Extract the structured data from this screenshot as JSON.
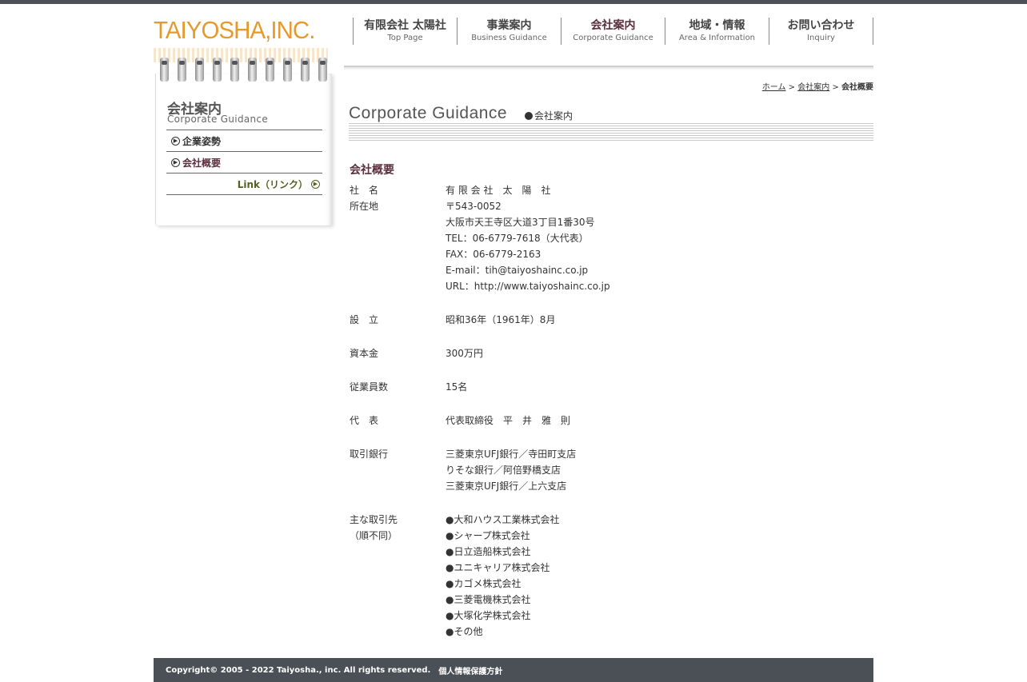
{
  "brand": {
    "logo_text": "TAIYOSHA,INC."
  },
  "global_nav": [
    {
      "jp": "有限会社 太陽社",
      "en": "Top Page"
    },
    {
      "jp": "事業案内",
      "en": "Business Guidance"
    },
    {
      "jp": "会社案内",
      "en": "Corporate Guidance"
    },
    {
      "jp": "地域・情報",
      "en": "Area & Information"
    },
    {
      "jp": "お問い合わせ",
      "en": "Inquiry"
    }
  ],
  "sidebar": {
    "title_jp": "会社案内",
    "title_en": "Corporate Guidance",
    "items": [
      {
        "label": "企業姿勢"
      },
      {
        "label": "会社概要"
      }
    ],
    "link_label": "Link（リンク）"
  },
  "breadcrumb": {
    "home": "ホーム",
    "sep1": ">",
    "section": "会社案内",
    "sep2": ">",
    "current": "会社概要"
  },
  "page_title": {
    "en": "Corporate Guidance",
    "jp": "会社案内"
  },
  "section_heading": "会社概要",
  "company_info": {
    "name": {
      "label": "社　名",
      "value": "有 限 会 社　太　陽　社"
    },
    "address": {
      "label": "所在地",
      "lines": [
        "〒543-0052",
        "大阪市天王寺区大道3丁目1番30号",
        "TEL：06-6779-7618（大代表）",
        "FAX：06-6779-2163",
        "E-mail：tih@taiyoshainc.co.jp",
        "URL：http://www.taiyoshainc.co.jp"
      ]
    },
    "founded": {
      "label": "設　立",
      "value": "昭和36年（1961年）8月"
    },
    "capital": {
      "label": "資本金",
      "value": "300万円"
    },
    "employees": {
      "label": "従業員数",
      "value": "15名"
    },
    "representative": {
      "label": "代　表",
      "value": "代表取締役　平　井　雅　則"
    },
    "banks": {
      "label": "取引銀行",
      "lines": [
        "三菱東京UFJ銀行／寺田町支店",
        "りそな銀行／阿倍野橋支店",
        "三菱東京UFJ銀行／上六支店"
      ]
    },
    "clients": {
      "label": "主な取引先",
      "label2": "（順不同）",
      "lines": [
        "●大和ハウス工業株式会社",
        "●シャープ株式会社",
        "●日立造船株式会社",
        "●ユニキャリア株式会社",
        "●カゴメ株式会社",
        "●三菱電機株式会社",
        "●大塚化学株式会社",
        "●その他"
      ]
    }
  },
  "footer": {
    "copyright": "Copyright© 2005 - 2022 Taiyosha., inc. All rights reserved.",
    "policy": "個人情報保護方針"
  },
  "colors": {
    "logo": "#e69a2e",
    "accent": "#5b2e3e",
    "link_green": "#556022",
    "dark_bar": "#4a5056"
  }
}
